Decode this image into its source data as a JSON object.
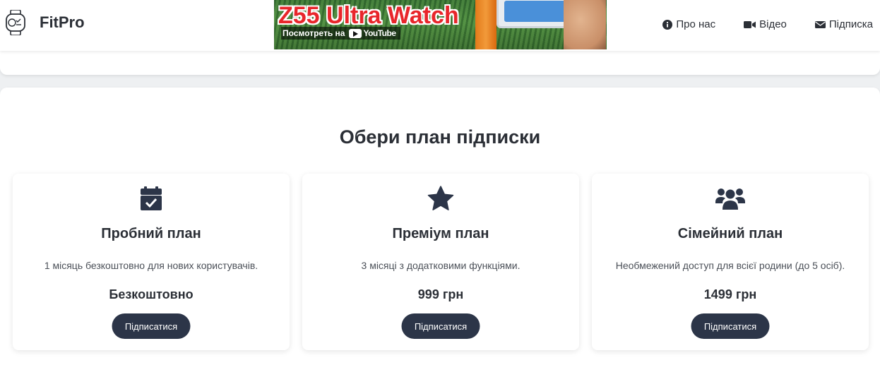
{
  "header": {
    "logo_text": "FitPro",
    "banner": {
      "title": "Z55 Ultra Watch",
      "watch_on": "Посмотреть на",
      "youtube": "YouTube"
    },
    "nav": [
      {
        "label": "Про нас",
        "icon": "info-circle-icon"
      },
      {
        "label": "Відео",
        "icon": "video-camera-icon"
      },
      {
        "label": "Підписка",
        "icon": "envelope-icon"
      }
    ]
  },
  "plans": {
    "title": "Обери план підписки",
    "items": [
      {
        "icon": "calendar-check-icon",
        "title": "Пробний план",
        "description": "1 місяць безкоштовно для нових користувачів.",
        "price": "Безкоштовно",
        "button": "Підписатися"
      },
      {
        "icon": "star-icon",
        "title": "Преміум план",
        "description": "3 місяці з додатковими функціями.",
        "price": "999 грн",
        "button": "Підписатися"
      },
      {
        "icon": "users-icon",
        "title": "Сімейний план",
        "description": "Необмежений доступ для всієї родини (до 5 осіб).",
        "price": "1499 грн",
        "button": "Підписатися"
      }
    ]
  },
  "colors": {
    "accent": "#2c3548",
    "banner_title": "#e8262b",
    "background": "#eef0f2"
  }
}
